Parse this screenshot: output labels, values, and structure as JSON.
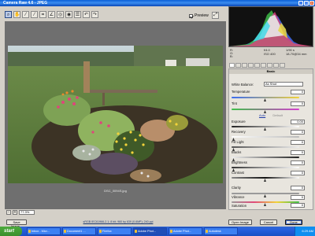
{
  "window": {
    "title": "Camera Raw 4.6  -  JPEG"
  },
  "toolbar": {
    "tools": [
      {
        "icon": "zoom-icon",
        "glyph": "⌕"
      },
      {
        "icon": "hand-icon",
        "glyph": "✋"
      },
      {
        "icon": "white-balance-icon",
        "glyph": "⁄"
      },
      {
        "icon": "color-sampler-icon",
        "glyph": "⁄"
      },
      {
        "icon": "crop-icon",
        "glyph": "⌗"
      },
      {
        "icon": "straighten-icon",
        "glyph": "∠"
      },
      {
        "icon": "retouch-icon",
        "glyph": "◎"
      },
      {
        "icon": "red-eye-icon",
        "glyph": "◉"
      },
      {
        "icon": "preferences-icon",
        "glyph": "☰"
      },
      {
        "icon": "rotate-left-icon",
        "glyph": "↶"
      },
      {
        "icon": "rotate-right-icon",
        "glyph": "↷"
      }
    ],
    "preview_label": "Preview",
    "fullscreen_glyph": "⤢"
  },
  "image": {
    "filename": "DSC_0094S.jpg"
  },
  "zoom": {
    "value": "77.3%",
    "minus": "-",
    "plus": "+"
  },
  "histogram_info": {
    "r": "R:",
    "g": "G:",
    "b": "B:",
    "fstop": "f/4.0",
    "shutter": "1/90 s",
    "iso": "ISO 400",
    "lens": "18-70@34 mm"
  },
  "panel": {
    "title": "Basic",
    "white_balance": {
      "label": "White Balance:",
      "value": "As Shot"
    },
    "temperature": {
      "label": "Temperature",
      "value": "0"
    },
    "tint": {
      "label": "Tint",
      "value": "0"
    },
    "auto_label": "Auto",
    "default_label": "Default",
    "exposure": {
      "label": "Exposure",
      "value": "0.00"
    },
    "recovery": {
      "label": "Recovery",
      "value": "0"
    },
    "fill_light": {
      "label": "Fill Light",
      "value": "0"
    },
    "blacks": {
      "label": "Blacks",
      "value": "0"
    },
    "brightness": {
      "label": "Brightness",
      "value": "0"
    },
    "contrast": {
      "label": "Contrast",
      "value": "0"
    },
    "clarity": {
      "label": "Clarity",
      "value": "0"
    },
    "vibrance": {
      "label": "Vibrance",
      "value": "0"
    },
    "saturation": {
      "label": "Saturation",
      "value": "0"
    }
  },
  "buttons": {
    "save": "Save Image...",
    "open": "Open Image",
    "cancel": "Cancel",
    "done": "Done"
  },
  "workflow": {
    "text": "sRGB IEC61966-2.1; 8 bit; 960 by 639 (0.6MP); 240 ppi"
  },
  "taskbar": {
    "start": "start",
    "tasks": [
      "Inbox - Micr...",
      "Document1 ...",
      "Firefox",
      "Adobe Phot...",
      "Adobe Phot...",
      "Autodesk"
    ],
    "clock": "6:29 AM"
  }
}
